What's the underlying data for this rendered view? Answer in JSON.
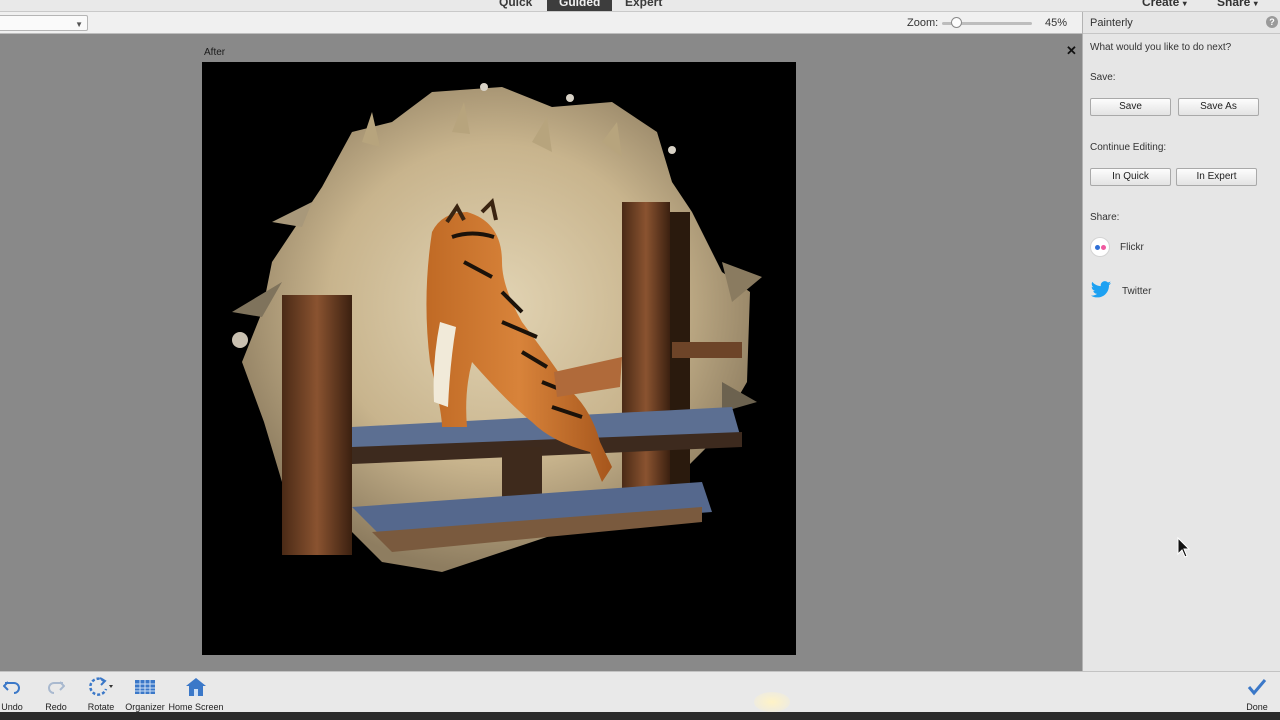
{
  "modes": {
    "tabs": [
      {
        "label": "Quick"
      },
      {
        "label": "Guided"
      },
      {
        "label": "Expert"
      }
    ],
    "active": "Guided",
    "create_label": "Create",
    "share_label": "Share"
  },
  "options": {
    "view_value": "",
    "zoom_label": "Zoom:",
    "zoom_value": "45%",
    "zoom_fraction": 0.1
  },
  "canvas": {
    "view_label": "After"
  },
  "panel": {
    "title": "Painterly",
    "help_glyph": "?",
    "prompt": "What would you like to do next?",
    "save_heading": "Save:",
    "save_button": "Save",
    "save_as_button": "Save As",
    "continue_heading": "Continue Editing:",
    "in_quick_button": "In Quick",
    "in_expert_button": "In Expert",
    "share_heading": "Share:",
    "share_items": [
      {
        "label": "Flickr",
        "icon": "flickr-icon"
      },
      {
        "label": "Twitter",
        "icon": "twitter-icon"
      }
    ],
    "twitter_color": "#1da1f2"
  },
  "toolbar": {
    "undo_label": "Undo",
    "redo_label": "Redo",
    "rotate_label": "Rotate",
    "organizer_label": "Organizer",
    "home_label": "Home Screen",
    "done_label": "Done",
    "accent": "#3b78c8"
  }
}
